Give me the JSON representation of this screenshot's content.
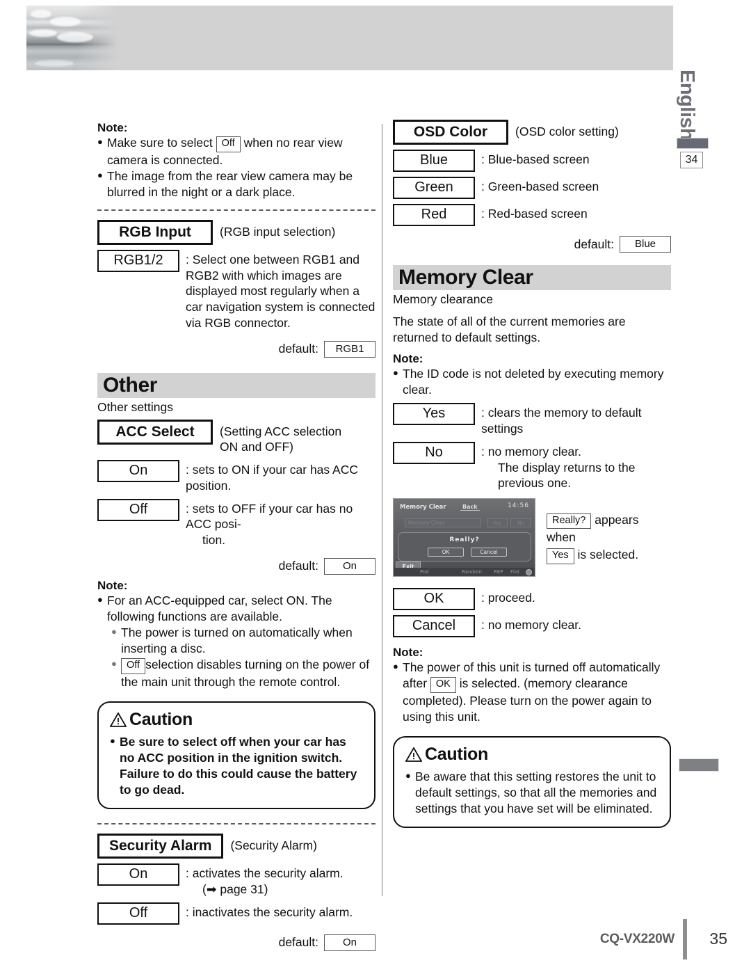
{
  "document": {
    "language_tab": "English",
    "page_reference": "34",
    "footer_model": "CQ-VX220W",
    "footer_page": "35"
  },
  "left_column": {
    "note_top": {
      "label": "Note:",
      "bullets": [
        {
          "pre": "Make sure to select",
          "key": "Off",
          "post": "when no rear view camera is connected."
        },
        {
          "pre": "The image from the rear view camera may be blurred in the night or a dark place.",
          "key": "",
          "post": ""
        }
      ]
    },
    "rgb_input": {
      "heading": "RGB Input",
      "heading_note": "(RGB input selection)",
      "options": [
        {
          "value": "RGB1/2",
          "desc": ": Select one between RGB1 and RGB2 with which images are displayed most regularly when a car navigation system is connected via RGB connector."
        }
      ],
      "default_label": "default:",
      "default_value": "RGB1"
    },
    "other_section": {
      "band_title": "Other",
      "subtitle": "Other settings"
    },
    "acc_select": {
      "heading": "ACC Select",
      "heading_note": "(Setting ACC selection ON and OFF)",
      "options": [
        {
          "value": "On",
          "desc": ": sets to ON if your car has ACC position."
        },
        {
          "value": "Off",
          "desc": ": sets to OFF if your car has no ACC posi-",
          "desc_indent": "tion."
        }
      ],
      "default_label": "default:",
      "default_value": "On"
    },
    "acc_note": {
      "label": "Note:",
      "main_bullet": "For an ACC-equipped car, select ON.  The following functions are available.",
      "sub_bullets": [
        {
          "pre": "The power is turned on automatically when inserting a disc.",
          "key": "",
          "post": ""
        },
        {
          "pre": "",
          "key": "Off",
          "post": "selection disables turning on the power of the main unit through the remote control."
        }
      ]
    },
    "acc_caution": {
      "title": "Caution",
      "bullets": [
        "Be sure to select off when your car has no ACC position in the ignition switch. Failure to do this could cause the battery to go dead."
      ]
    },
    "security_alarm": {
      "heading": "Security Alarm",
      "heading_note": "(Security Alarm)",
      "options": [
        {
          "value": "On",
          "desc": ": activates the security alarm.",
          "desc_indent": "(➡ page 31)"
        },
        {
          "value": "Off",
          "desc": ": inactivates the security alarm."
        }
      ],
      "default_label": "default:",
      "default_value": "On"
    }
  },
  "right_column": {
    "osd_color": {
      "heading": "OSD Color",
      "heading_note": "(OSD color setting)",
      "options": [
        {
          "value": "Blue",
          "desc": ": Blue-based screen"
        },
        {
          "value": "Green",
          "desc": ": Green-based screen"
        },
        {
          "value": "Red",
          "desc": ": Red-based screen"
        }
      ],
      "default_label": "default:",
      "default_value": "Blue"
    },
    "memory_clear": {
      "band_title": "Memory Clear",
      "subtitle": "Memory clearance",
      "body": "The state of all of the current memories are returned to default settings.",
      "note_label": "Note:",
      "note_bullet": "The ID code is not deleted by executing memory clear.",
      "options": [
        {
          "value": "Yes",
          "desc": ": clears the memory to default settings"
        },
        {
          "value": "No",
          "desc": ": no memory clear.",
          "desc_indent": "The display returns to the previous one."
        }
      ],
      "screenshot": {
        "title": "Memory Clear",
        "back_button": "Back",
        "clock": "14:56",
        "field_text": "Memory Clear",
        "mini_button_1": "Yes",
        "mini_button_2": "No",
        "dialog_question": "Really?",
        "dialog_ok": "OK",
        "dialog_cancel": "Cancel",
        "exit_button": "Exit",
        "footer_1": "Pod",
        "footer_2": "Random",
        "footer_3": "REP",
        "footer_4": "Flat"
      },
      "caption": {
        "key1": "Really?",
        "text1": "appears when",
        "key2": "Yes",
        "text2": "is selected."
      },
      "confirm_options": [
        {
          "value": "OK",
          "desc": ": proceed."
        },
        {
          "value": "Cancel",
          "desc": ": no memory clear."
        }
      ],
      "note2_label": "Note:",
      "note2_pre": "The power of this unit is turned off automatically after",
      "note2_key": "OK",
      "note2_post": "is selected. (memory clearance completed). Please turn on the power again to using this unit."
    },
    "memory_caution": {
      "title": "Caution",
      "bullets": [
        "Be aware that this setting restores the unit to default settings, so that all the memories and settings that you have set will be eliminated."
      ]
    }
  }
}
